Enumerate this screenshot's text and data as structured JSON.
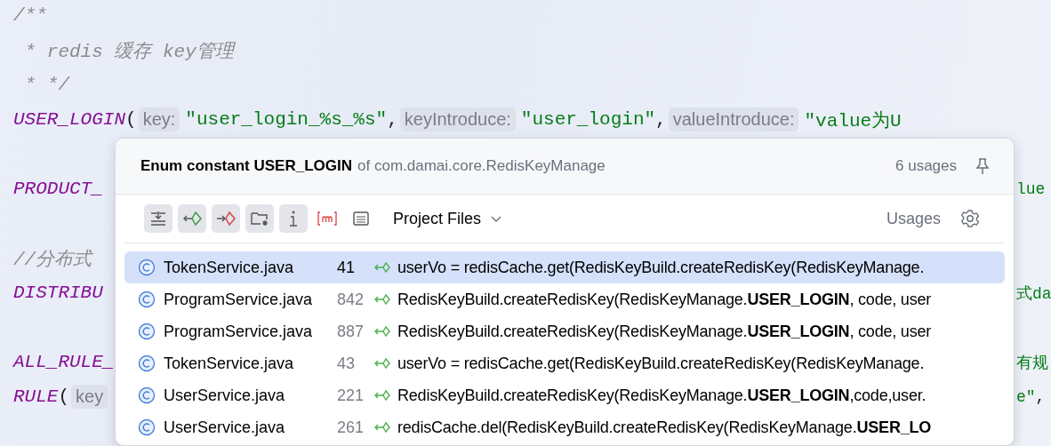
{
  "code_lines": [
    {
      "left": [
        {
          "kind": "comment",
          "text": "/**"
        }
      ]
    },
    {
      "left": [
        {
          "kind": "comment",
          "text": " * redis 缓存 key管理"
        }
      ]
    },
    {
      "left": [
        {
          "kind": "comment",
          "text": " * */"
        }
      ]
    },
    {
      "left": [
        {
          "kind": "constant",
          "text": "USER_LOGIN"
        },
        {
          "kind": "punct",
          "text": "("
        },
        {
          "kind": "inlay",
          "text": "key:"
        },
        {
          "kind": "string",
          "text": "\"user_login_%s_%s\""
        },
        {
          "kind": "punct",
          "text": ","
        },
        {
          "kind": "inlay",
          "text": "keyIntroduce:"
        },
        {
          "kind": "string",
          "text": "\"user_login\""
        },
        {
          "kind": "punct",
          "text": ","
        },
        {
          "kind": "inlay",
          "text": "valueIntroduce:"
        },
        {
          "kind": "string",
          "text": "\"value为U"
        }
      ]
    },
    {
      "gap_before": true,
      "left": [
        {
          "kind": "constant",
          "text": "PRODUCT_"
        }
      ],
      "right": [
        {
          "kind": "string",
          "text": "lue"
        }
      ]
    },
    {
      "gap_before": true,
      "left": [
        {
          "kind": "comment",
          "text": "//分布式"
        }
      ]
    },
    {
      "left": [
        {
          "kind": "constant",
          "text": "DISTRIBU"
        }
      ],
      "right": [
        {
          "kind": "string",
          "text": "式da"
        }
      ]
    },
    {
      "gap_before": true,
      "left": [
        {
          "kind": "constant",
          "text": "ALL_RULE_"
        }
      ],
      "right": [
        {
          "kind": "string",
          "text": "有规"
        }
      ]
    },
    {
      "left": [
        {
          "kind": "constant",
          "text": "RULE"
        },
        {
          "kind": "punct",
          "text": "("
        },
        {
          "kind": "inlay",
          "text": "key"
        }
      ],
      "right": [
        {
          "kind": "string",
          "text": "e\""
        },
        {
          "kind": "punct",
          "text": ","
        }
      ]
    }
  ],
  "popup": {
    "title": "Enum constant USER_LOGIN",
    "subtitle": "of com.damai.core.RedisKeyManage",
    "usage_count": "6 usages",
    "toggles": [
      {
        "on": true
      },
      {
        "on": true
      },
      {
        "on": true
      },
      {
        "on": true
      },
      {
        "on": true
      },
      {
        "on": false
      },
      {
        "on": false
      }
    ],
    "scope": "Project Files",
    "mode": "Usages",
    "rows": [
      {
        "file": "TokenService.java",
        "line": "41",
        "code": "userVo = redisCache.get(RedisKeyBuild.createRedisKey(RedisKeyManage.",
        "selected": true
      },
      {
        "file": "ProgramService.java",
        "line": "842",
        "code": "RedisKeyBuild.createRedisKey(RedisKeyManage.**USER_LOGIN**, code, user",
        "selected": false
      },
      {
        "file": "ProgramService.java",
        "line": "887",
        "code": "RedisKeyBuild.createRedisKey(RedisKeyManage.**USER_LOGIN**, code, user",
        "selected": false
      },
      {
        "file": "TokenService.java",
        "line": "43",
        "code": "userVo = redisCache.get(RedisKeyBuild.createRedisKey(RedisKeyManage.",
        "selected": false
      },
      {
        "file": "UserService.java",
        "line": "221",
        "code": "RedisKeyBuild.createRedisKey(RedisKeyManage.**USER_LOGIN**,code,user.",
        "selected": false
      },
      {
        "file": "UserService.java",
        "line": "261",
        "code": "redisCache.del(RedisKeyBuild.createRedisKey(RedisKeyManage.**USER_LO**",
        "selected": false
      }
    ]
  }
}
